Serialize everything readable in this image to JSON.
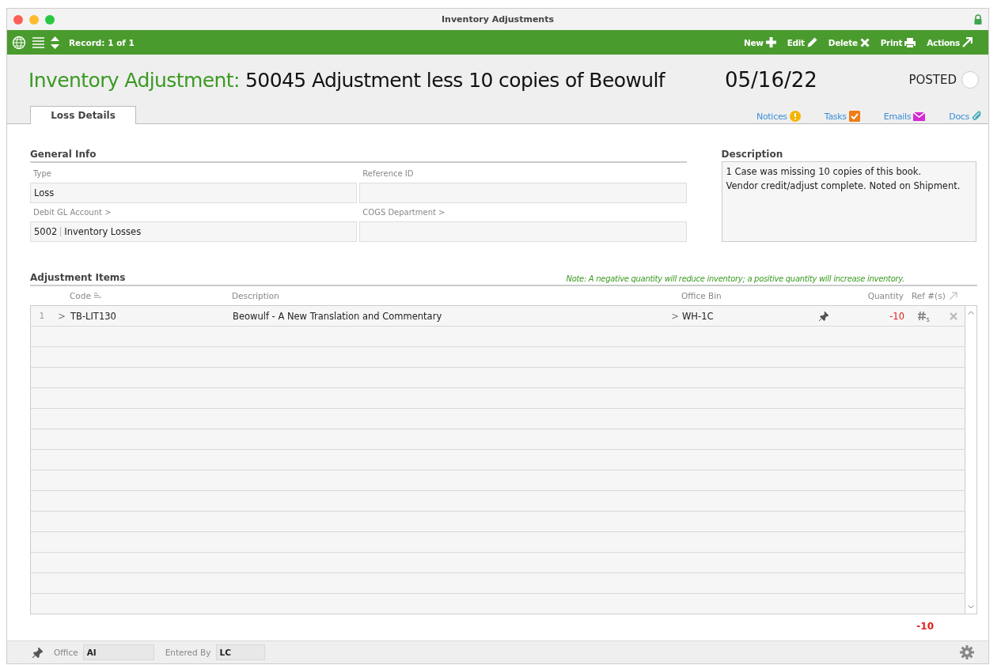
{
  "window": {
    "title": "Inventory Adjustments"
  },
  "toolbar": {
    "record": "Record: 1 of 1",
    "actions": [
      {
        "label": "New",
        "kind": "new"
      },
      {
        "label": "Edit",
        "kind": "edit"
      },
      {
        "label": "Delete",
        "kind": "delete"
      },
      {
        "label": "Print",
        "kind": "print"
      },
      {
        "label": "Actions",
        "kind": "actions"
      }
    ]
  },
  "header": {
    "prefix": "Inventory Adjustment:",
    "title": "50045 Adjustment less 10 copies of Beowulf",
    "date": "05/16/22",
    "status": "POSTED",
    "posted": false
  },
  "tabs": [
    {
      "label": "Loss Details",
      "selected": true
    }
  ],
  "links": [
    {
      "label": "Notices",
      "kind": "notices"
    },
    {
      "label": "Tasks",
      "kind": "tasks"
    },
    {
      "label": "Emails",
      "kind": "emails"
    },
    {
      "label": "Docs",
      "kind": "docs"
    }
  ],
  "general_info": {
    "heading": "General Info",
    "fields": [
      {
        "label": "Type",
        "value": "Loss"
      },
      {
        "label": "Reference ID"
      },
      {
        "label": "Debit GL Account >",
        "value": "5002",
        "value_2": "Inventory Losses"
      },
      {
        "label": "COGS Department >"
      }
    ]
  },
  "description": {
    "heading": "Description",
    "lines": [
      "1 Case was missing 10 copies of this book.",
      "Vendor credit/adjust complete.  Noted on Shipment."
    ]
  },
  "items": {
    "heading": "Adjustment Items",
    "note": "Note: A negative quantity will reduce inventory; a positive quantity will increase inventory.",
    "columns": [
      "Code",
      "Description",
      "Office Bin",
      "Quantity",
      "Ref #(s)"
    ],
    "rows": [
      {
        "number": "1",
        "expand": ">",
        "code": "TB-LIT130",
        "description": "Beowulf - A New Translation and Commentary",
        "bin_arrow": ">",
        "bin": "WH-1C",
        "quantity": "-10",
        "negative": true
      }
    ],
    "total": "-10",
    "total_negative": true
  },
  "footer": {
    "office_label": "Office",
    "office": "AI",
    "entered_by_label": "Entered By",
    "entered_by": "LC"
  }
}
